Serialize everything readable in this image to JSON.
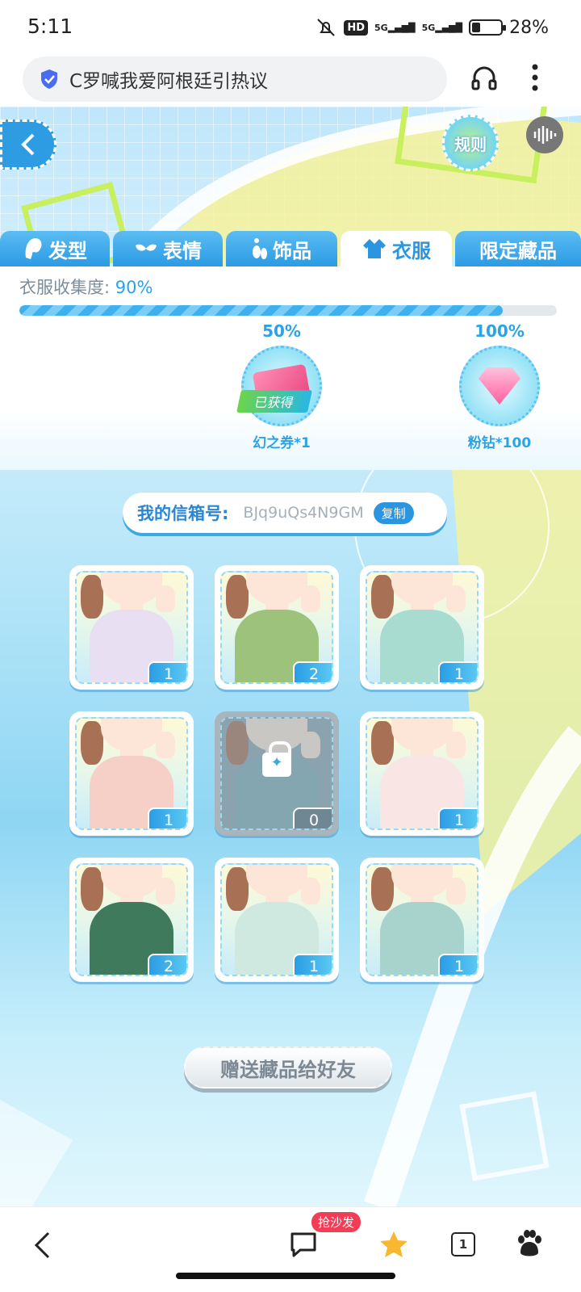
{
  "status": {
    "time": "5:11",
    "network": "5G",
    "hd": "HD",
    "battery": "28%"
  },
  "browser": {
    "title": "C罗喊我爱阿根廷引热议"
  },
  "game": {
    "rule_label": "规则",
    "tabs": [
      {
        "label": "发型",
        "active": false
      },
      {
        "label": "表情",
        "active": false
      },
      {
        "label": "饰品",
        "active": false
      },
      {
        "label": "衣服",
        "active": true
      },
      {
        "label": "限定藏品",
        "active": false
      }
    ],
    "collection": {
      "label": "衣服收集度:",
      "value": "90%",
      "progress": 0.9
    },
    "milestones": [
      {
        "pct": "50%",
        "reward": "幻之券*1",
        "status": "已获得",
        "icon": "ticket-icon"
      },
      {
        "pct": "100%",
        "reward": "粉钻*100",
        "icon": "pink-diamond-icon"
      }
    ],
    "mailbox": {
      "label": "我的信箱号:",
      "code": "BJq9uQs4N9GM",
      "copy_label": "复制"
    },
    "items": [
      {
        "count": "1",
        "locked": false,
        "outfit": "#e8e0f2"
      },
      {
        "count": "2",
        "locked": false,
        "outfit": "#9cc27c"
      },
      {
        "count": "1",
        "locked": false,
        "outfit": "#a9dcd0"
      },
      {
        "count": "1",
        "locked": false,
        "outfit": "#f6cfc6"
      },
      {
        "count": "0",
        "locked": true,
        "outfit": "#7fa9b2"
      },
      {
        "count": "1",
        "locked": false,
        "outfit": "#f9e6e4"
      },
      {
        "count": "2",
        "locked": false,
        "outfit": "#3f7a5c"
      },
      {
        "count": "1",
        "locked": false,
        "outfit": "#cfe9e0"
      },
      {
        "count": "1",
        "locked": false,
        "outfit": "#a8d3cd"
      }
    ],
    "gift_button": "赠送藏品给好友"
  },
  "nav": {
    "comment_badge": "抢沙发",
    "tab_count": "1"
  }
}
